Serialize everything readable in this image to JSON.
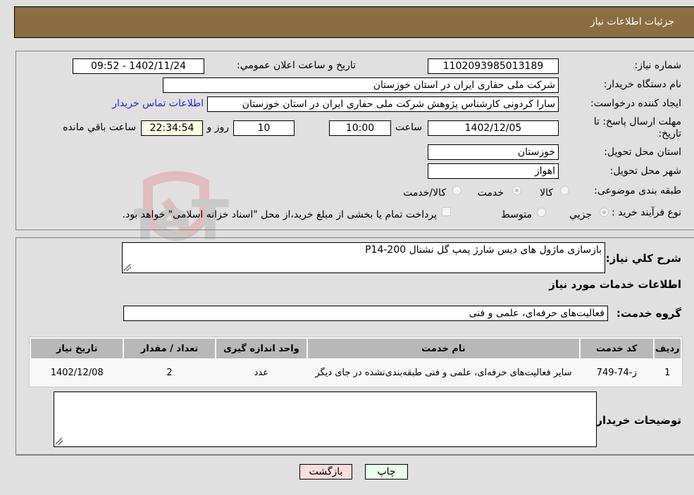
{
  "header": {
    "title": "جزئیات اطلاعات نیاز"
  },
  "form": {
    "need_number": {
      "label": "شماره نیاز:",
      "value": "1102093985013189"
    },
    "announce_datetime": {
      "label": "تاریخ و ساعت اعلان عمومي:",
      "value": "1402/11/24 - 09:52"
    },
    "buyer_org": {
      "label": "نام دستگاه خریدار:",
      "value": "شرکت ملی حفاری ایران در استان خوزستان"
    },
    "requester": {
      "label": "ایجاد کننده درخواست:",
      "value": "سارا کردونی کارشناس پژوهش شرکت ملی حفاری ایران در استان خوزستان"
    },
    "buyer_contact_link": "اطلاعات تماس خریدار",
    "deadline": {
      "label": "مهلت ارسال پاسخ: تا تاریخ:",
      "date": "1402/12/05",
      "time_label": "ساعت",
      "time": "10:00",
      "days": "10",
      "days_label": "روز و",
      "remaining": "22:34:54",
      "remaining_label": "ساعت باقي مانده"
    },
    "delivery_province": {
      "label": "استان محل تحویل:",
      "value": "خوزستان"
    },
    "delivery_city": {
      "label": "شهر محل تحویل:",
      "value": "اهواز"
    },
    "category": {
      "label": "طبقه بندی موضوعی:",
      "options": [
        "کالا",
        "خدمت",
        "کالا/خدمت"
      ],
      "selected": "خدمت"
    },
    "purchase_type": {
      "label": "نوع فرآیند خرید :",
      "options": [
        "جزيي",
        "متوسط"
      ],
      "selected": "جزيي",
      "treasury_note": "پرداخت تمام یا بخشی از مبلغ خرید،از محل \"اسناد خزانه اسلامی\" خواهد بود."
    }
  },
  "details": {
    "description_label": "شرح کلي نياز:",
    "description": "بازسازی ماژول های دیس شارژ پمپ گل نشنال P14-200",
    "services_heading": "اطلاعات خدمات مورد نیاز",
    "service_group_label": "گروه خدمت:",
    "service_group": "فعالیت‌های حرفه‌ای، علمی و فنی",
    "table": {
      "headers": [
        "ردیف",
        "کد خدمت",
        "نام خدمت",
        "واحد اندازه گیری",
        "تعداد / مقدار",
        "تاریخ نیاز"
      ],
      "rows": [
        [
          "1",
          "ز-74-749",
          "سایر فعالیت‌های حرفه‌ای، علمی و فنی طبقه‌بندی‌نشده در جای دیگر",
          "عدد",
          "2",
          "1402/12/08"
        ]
      ]
    },
    "buyer_notes_label": "توضیحات خریدار:",
    "buyer_notes": ""
  },
  "buttons": {
    "print": "چاپ",
    "back": "بازگشت"
  },
  "watermark": "AriaTender.neT",
  "colors": {
    "header_bg": "#8b6d42",
    "print_bg": "#eaffea",
    "back_bg": "#ffdddd",
    "link": "#2525d9"
  }
}
